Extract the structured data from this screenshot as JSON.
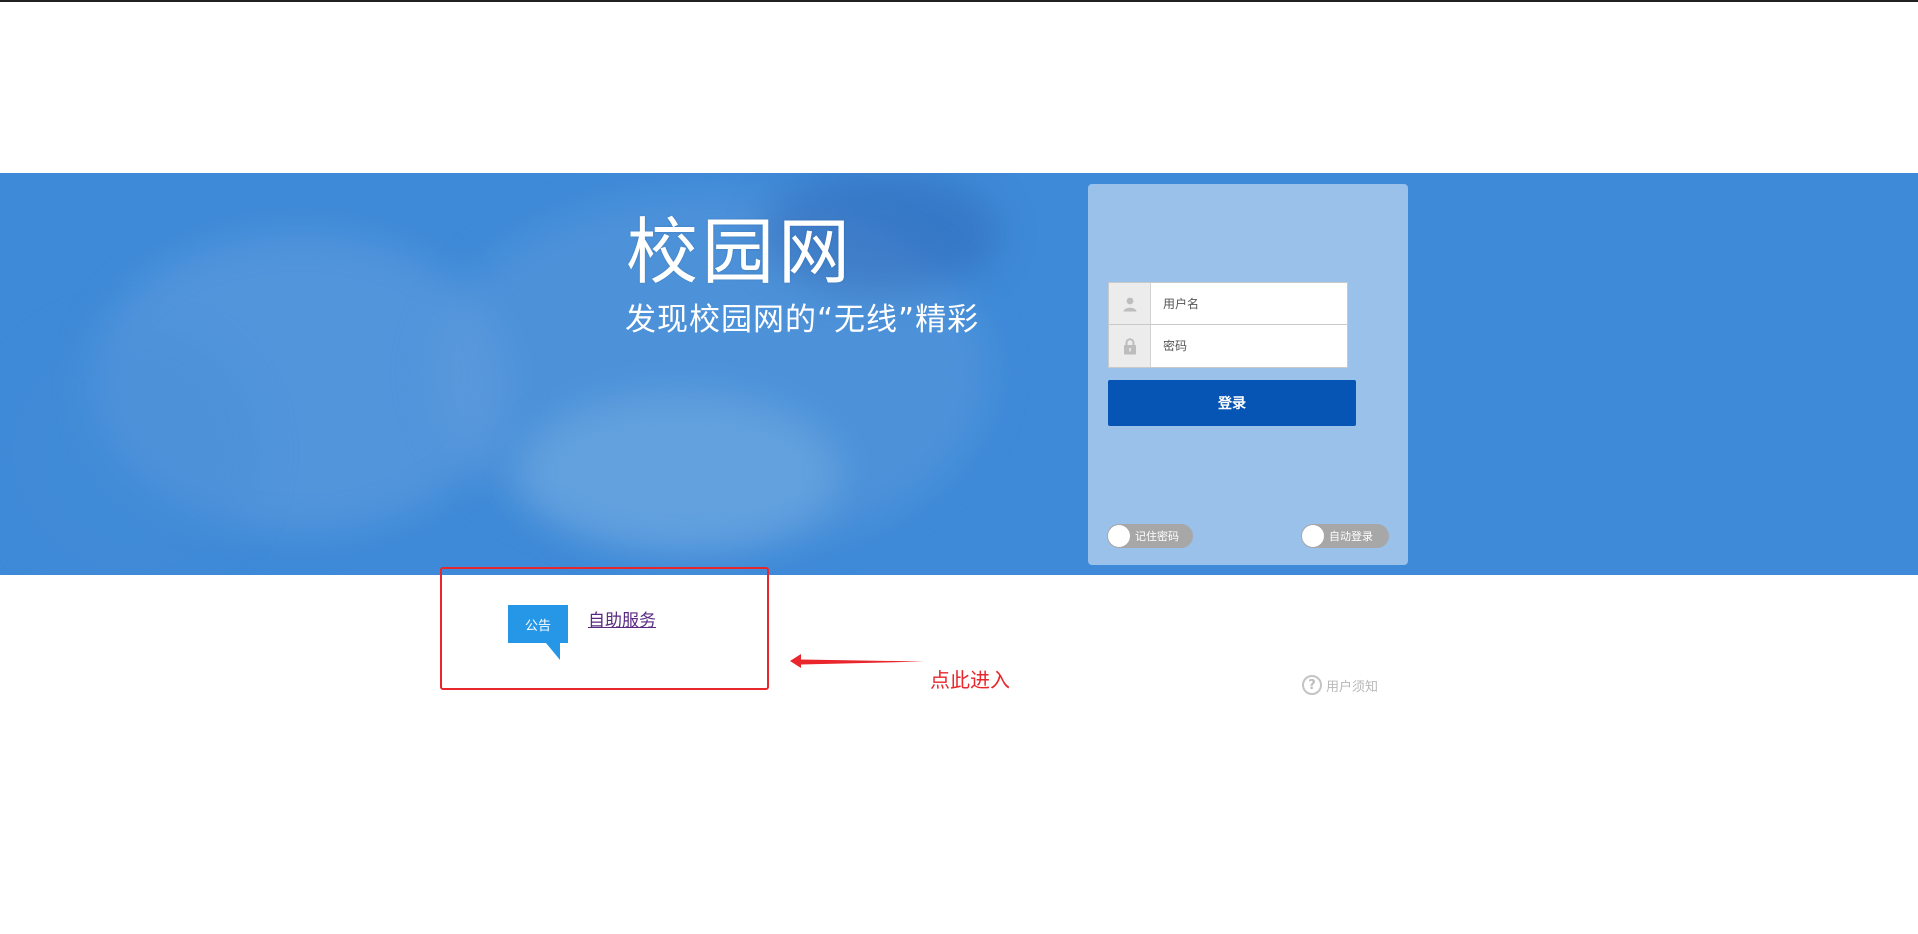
{
  "brand": {
    "title": "校园网",
    "slogan": "发现校园网的“无线”精彩"
  },
  "login": {
    "username_placeholder": "用户名",
    "password_placeholder": "密码",
    "submit_label": "登录",
    "remember_label": "记住密码",
    "auto_login_label": "自动登录",
    "user_icon": "user-icon",
    "lock_icon": "lock-icon"
  },
  "notice": {
    "badge": "公告",
    "link": "自助服务"
  },
  "annotation": {
    "hint": "点此进入"
  },
  "footer": {
    "user_notice": "用户须知",
    "help_glyph": "?"
  },
  "colors": {
    "banner": "#3e8ad8",
    "login_button": "#0654b3",
    "notice_badge": "#2597e6",
    "annotation_red": "#e8262b"
  }
}
